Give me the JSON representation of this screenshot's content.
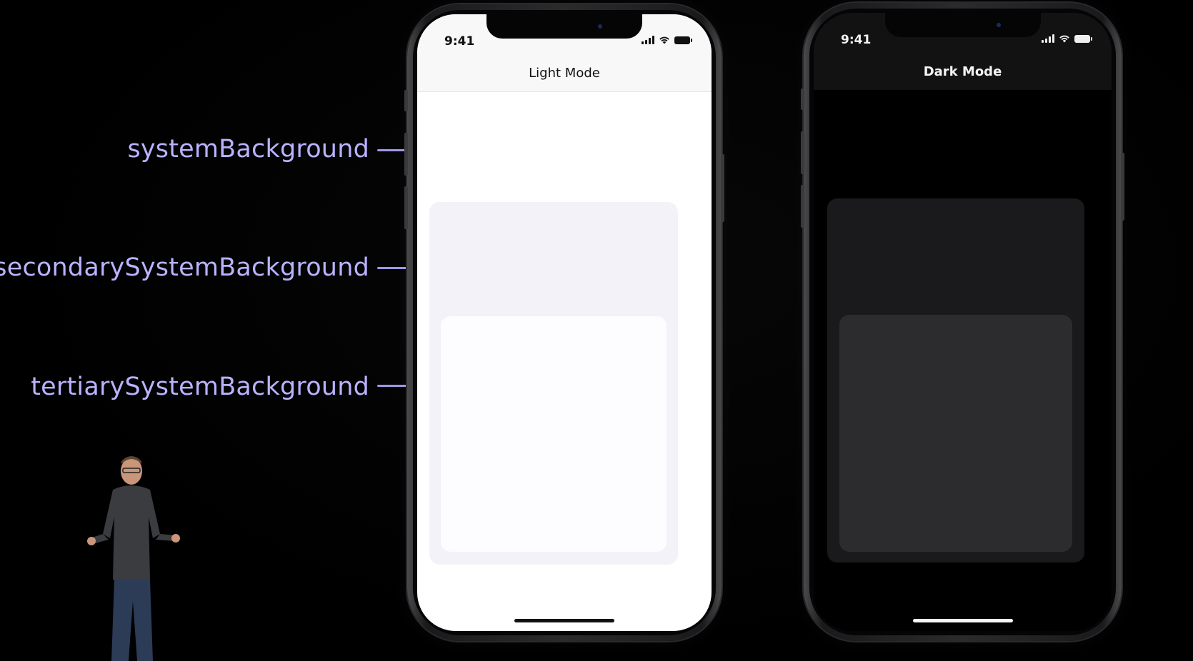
{
  "labels": {
    "system": "systemBackground",
    "secondary": "secondarySystemBackground",
    "tertiary": "tertiarySystemBackground"
  },
  "phones": {
    "light": {
      "time": "9:41",
      "title": "Light Mode"
    },
    "dark": {
      "time": "9:41",
      "title": "Dark Mode"
    }
  },
  "colors": {
    "label": "#b9b2ff",
    "leader": "#9f98e6",
    "light_system_background": "#ffffff",
    "light_secondary_background": "#f3f2f8",
    "light_tertiary_background": "#fdfcff",
    "dark_system_background": "#000000",
    "dark_secondary_background": "#1a1a1c",
    "dark_tertiary_background": "#2c2c2e"
  }
}
